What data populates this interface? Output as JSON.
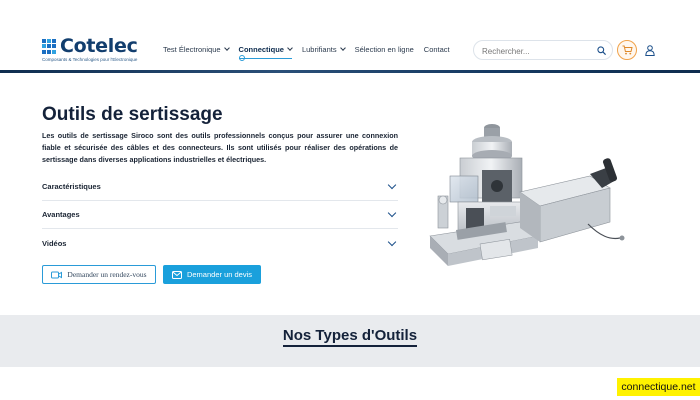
{
  "header": {
    "logo_text": "Cotelec",
    "logo_tagline": "Composants & Technologies pour l'Electronique",
    "nav": [
      {
        "label": "Test Électronique",
        "dropdown": true,
        "active": false
      },
      {
        "label": "Connectique",
        "dropdown": true,
        "active": true
      },
      {
        "label": "Lubrifiants",
        "dropdown": true,
        "active": false
      },
      {
        "label": "Sélection en ligne",
        "dropdown": false,
        "active": false
      },
      {
        "label": "Contact",
        "dropdown": false,
        "active": false
      }
    ],
    "search_placeholder": "Rechercher...",
    "icons": {
      "search": "search-icon",
      "cart": "cart-icon",
      "user": "user-icon"
    }
  },
  "hero": {
    "title": "Outils de sertissage",
    "description": "Les outils de sertissage Siroco sont des outils professionnels conçus pour assurer une connexion fiable et sécurisée des câbles et des connecteurs. Ils sont utilisés pour réaliser des opérations de sertissage dans diverses applications industrielles et électriques.",
    "accordion": [
      {
        "label": "Caractéristiques"
      },
      {
        "label": "Avantages"
      },
      {
        "label": "Vidéos"
      }
    ],
    "buttons": {
      "rdv": "Demander un rendez-vous",
      "devis": "Demander un devis"
    },
    "image": "crimping-machine-image"
  },
  "section": {
    "title": "Nos Types d'Outils"
  },
  "watermark": "connectique.net",
  "colors": {
    "brand_dark": "#123e6e",
    "accent": "#1aa0dc",
    "cart_accent": "#f0a24a",
    "section_bg": "#e9ebee"
  }
}
